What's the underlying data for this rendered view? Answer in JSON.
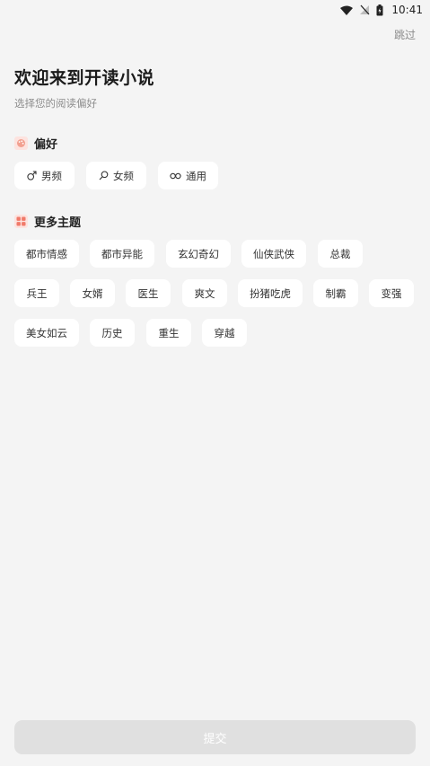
{
  "status": {
    "time": "10:41"
  },
  "header": {
    "skip": "跳过",
    "title": "欢迎来到开读小说",
    "subtitle": "选择您的阅读偏好"
  },
  "preferences": {
    "title": "偏好",
    "icon": "palette-icon",
    "options": [
      {
        "label": "男频",
        "icon": "male-symbol-icon"
      },
      {
        "label": "女频",
        "icon": "female-symbol-icon"
      },
      {
        "label": "通用",
        "icon": "link-icon"
      }
    ]
  },
  "themes": {
    "title": "更多主题",
    "icon": "grid-icon",
    "items": [
      "都市情感",
      "都市异能",
      "玄幻奇幻",
      "仙侠武侠",
      "总裁",
      "兵王",
      "女婿",
      "医生",
      "爽文",
      "扮猪吃虎",
      "制霸",
      "变强",
      "美女如云",
      "历史",
      "重生",
      "穿越"
    ]
  },
  "footer": {
    "submit": "提交"
  },
  "colors": {
    "background": "#f4f4f4",
    "chip": "#ffffff",
    "submit_disabled": "#e0e0e0",
    "accent": "#f07a6a"
  }
}
